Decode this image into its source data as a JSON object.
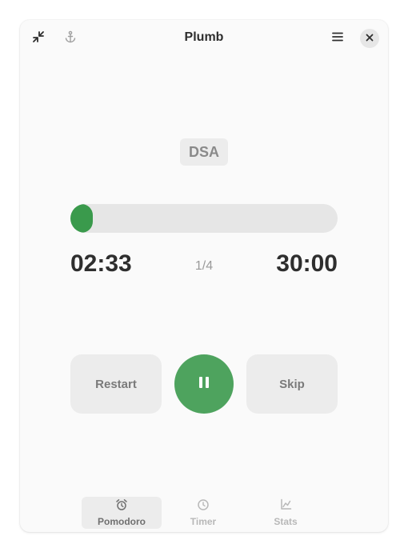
{
  "app": {
    "title": "Plumb"
  },
  "header": {
    "minimize_icon": "minimize-icon",
    "anchor_icon": "anchor-icon",
    "menu_icon": "hamburger-menu-icon",
    "close_icon": "close-icon"
  },
  "session": {
    "tag": "DSA",
    "elapsed": "02:33",
    "round": "1/4",
    "duration": "30:00",
    "progress_fraction": 0.085
  },
  "controls": {
    "restart_label": "Restart",
    "pause_icon": "pause-icon",
    "skip_label": "Skip"
  },
  "nav": {
    "items": [
      {
        "label": "Pomodoro",
        "icon": "alarm-clock-icon",
        "active": true
      },
      {
        "label": "Timer",
        "icon": "clock-icon",
        "active": false
      },
      {
        "label": "Stats",
        "icon": "chart-axes-icon",
        "active": false
      }
    ]
  },
  "colors": {
    "accent_green": "#3a9a4c",
    "button_green": "#4ea35e",
    "window_bg": "#fafafa"
  }
}
